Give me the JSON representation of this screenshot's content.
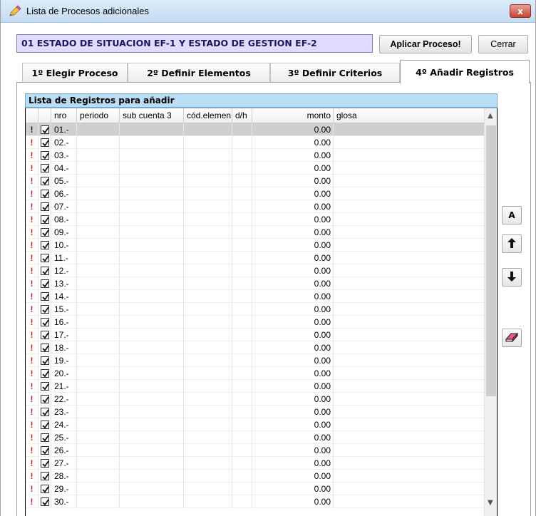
{
  "window": {
    "title": "Lista de Procesos adicionales",
    "close_label": "x"
  },
  "process": {
    "name": "01 ESTADO DE SITUACION EF-1 Y ESTADO DE GESTION EF-2"
  },
  "toolbar": {
    "apply_label": "Aplicar Proceso!",
    "close_label": "Cerrar"
  },
  "tabs": [
    {
      "label": "1º Elegir Proceso",
      "active": false
    },
    {
      "label": "2º Definir Elementos",
      "active": false
    },
    {
      "label": "3º Definir Criterios",
      "active": false
    },
    {
      "label": "4º Añadir Registros",
      "active": true
    }
  ],
  "group": {
    "title": "Lista de Registros para añadir"
  },
  "grid": {
    "columns": [
      "",
      "",
      "nro",
      "periodo",
      "sub cuenta 3",
      "cód.elemen",
      "d/h",
      "monto",
      "glosa"
    ],
    "warning_glyph": "!",
    "rows": [
      {
        "nro": "01.-",
        "monto": "0.00",
        "checked": true
      },
      {
        "nro": "02.-",
        "monto": "0.00",
        "checked": true
      },
      {
        "nro": "03.-",
        "monto": "0.00",
        "checked": true
      },
      {
        "nro": "04.-",
        "monto": "0.00",
        "checked": true
      },
      {
        "nro": "05.-",
        "monto": "0.00",
        "checked": true
      },
      {
        "nro": "06.-",
        "monto": "0.00",
        "checked": true
      },
      {
        "nro": "07.-",
        "monto": "0.00",
        "checked": true
      },
      {
        "nro": "08.-",
        "monto": "0.00",
        "checked": true
      },
      {
        "nro": "09.-",
        "monto": "0.00",
        "checked": true
      },
      {
        "nro": "10.-",
        "monto": "0.00",
        "checked": true
      },
      {
        "nro": "11.-",
        "monto": "0.00",
        "checked": true
      },
      {
        "nro": "12.-",
        "monto": "0.00",
        "checked": true
      },
      {
        "nro": "13.-",
        "monto": "0.00",
        "checked": true
      },
      {
        "nro": "14.-",
        "monto": "0.00",
        "checked": true
      },
      {
        "nro": "15.-",
        "monto": "0.00",
        "checked": true
      },
      {
        "nro": "16.-",
        "monto": "0.00",
        "checked": true
      },
      {
        "nro": "17.-",
        "monto": "0.00",
        "checked": true
      },
      {
        "nro": "18.-",
        "monto": "0.00",
        "checked": true
      },
      {
        "nro": "19.-",
        "monto": "0.00",
        "checked": true
      },
      {
        "nro": "20.-",
        "monto": "0.00",
        "checked": true
      },
      {
        "nro": "21.-",
        "monto": "0.00",
        "checked": true
      },
      {
        "nro": "22.-",
        "monto": "0.00",
        "checked": true
      },
      {
        "nro": "23.-",
        "monto": "0.00",
        "checked": true
      },
      {
        "nro": "24.-",
        "monto": "0.00",
        "checked": true
      },
      {
        "nro": "25.-",
        "monto": "0.00",
        "checked": true
      },
      {
        "nro": "26.-",
        "monto": "0.00",
        "checked": true
      },
      {
        "nro": "27.-",
        "monto": "0.00",
        "checked": true
      },
      {
        "nro": "28.-",
        "monto": "0.00",
        "checked": true
      },
      {
        "nro": "29.-",
        "monto": "0.00",
        "checked": true
      },
      {
        "nro": "30.-",
        "monto": "0.00",
        "checked": true
      }
    ],
    "selected_row": 0
  },
  "side_buttons": {
    "a_label": "A",
    "up_glyph": "🡅",
    "down_glyph": "🡇"
  },
  "icons": {
    "title": "pencil-icon",
    "eraser": "eraser-icon"
  },
  "colors": {
    "process_bg": "#e0dcff",
    "group_header_bg": "#b9ddf4",
    "warning": "#d31b1b",
    "selected_row": "#cfcfcf"
  }
}
